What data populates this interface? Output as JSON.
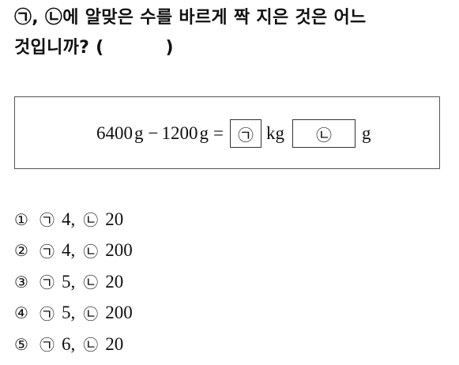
{
  "question": {
    "line1": "㉠, ㉡에 알맞은 수를 바르게 짝 지은 것은 어느",
    "line2_text": "것입니까? (",
    "line2_close": ")"
  },
  "equation": {
    "num1": "6400",
    "unit1": "g",
    "minus": "−",
    "num2": "1200",
    "unit2": "g",
    "equals": "=",
    "blank_a": "㉠",
    "unit_kg": "kg",
    "blank_b": "㉡",
    "unit_g": "g"
  },
  "choices": [
    {
      "num": "①",
      "a_sym": "㉠",
      "a_val": "4",
      "b_sym": "㉡",
      "b_val": "20"
    },
    {
      "num": "②",
      "a_sym": "㉠",
      "a_val": "4",
      "b_sym": "㉡",
      "b_val": "200"
    },
    {
      "num": "③",
      "a_sym": "㉠",
      "a_val": "5",
      "b_sym": "㉡",
      "b_val": "20"
    },
    {
      "num": "④",
      "a_sym": "㉠",
      "a_val": "5",
      "b_sym": "㉡",
      "b_val": "200"
    },
    {
      "num": "⑤",
      "a_sym": "㉠",
      "a_val": "6",
      "b_sym": "㉡",
      "b_val": "20"
    }
  ]
}
